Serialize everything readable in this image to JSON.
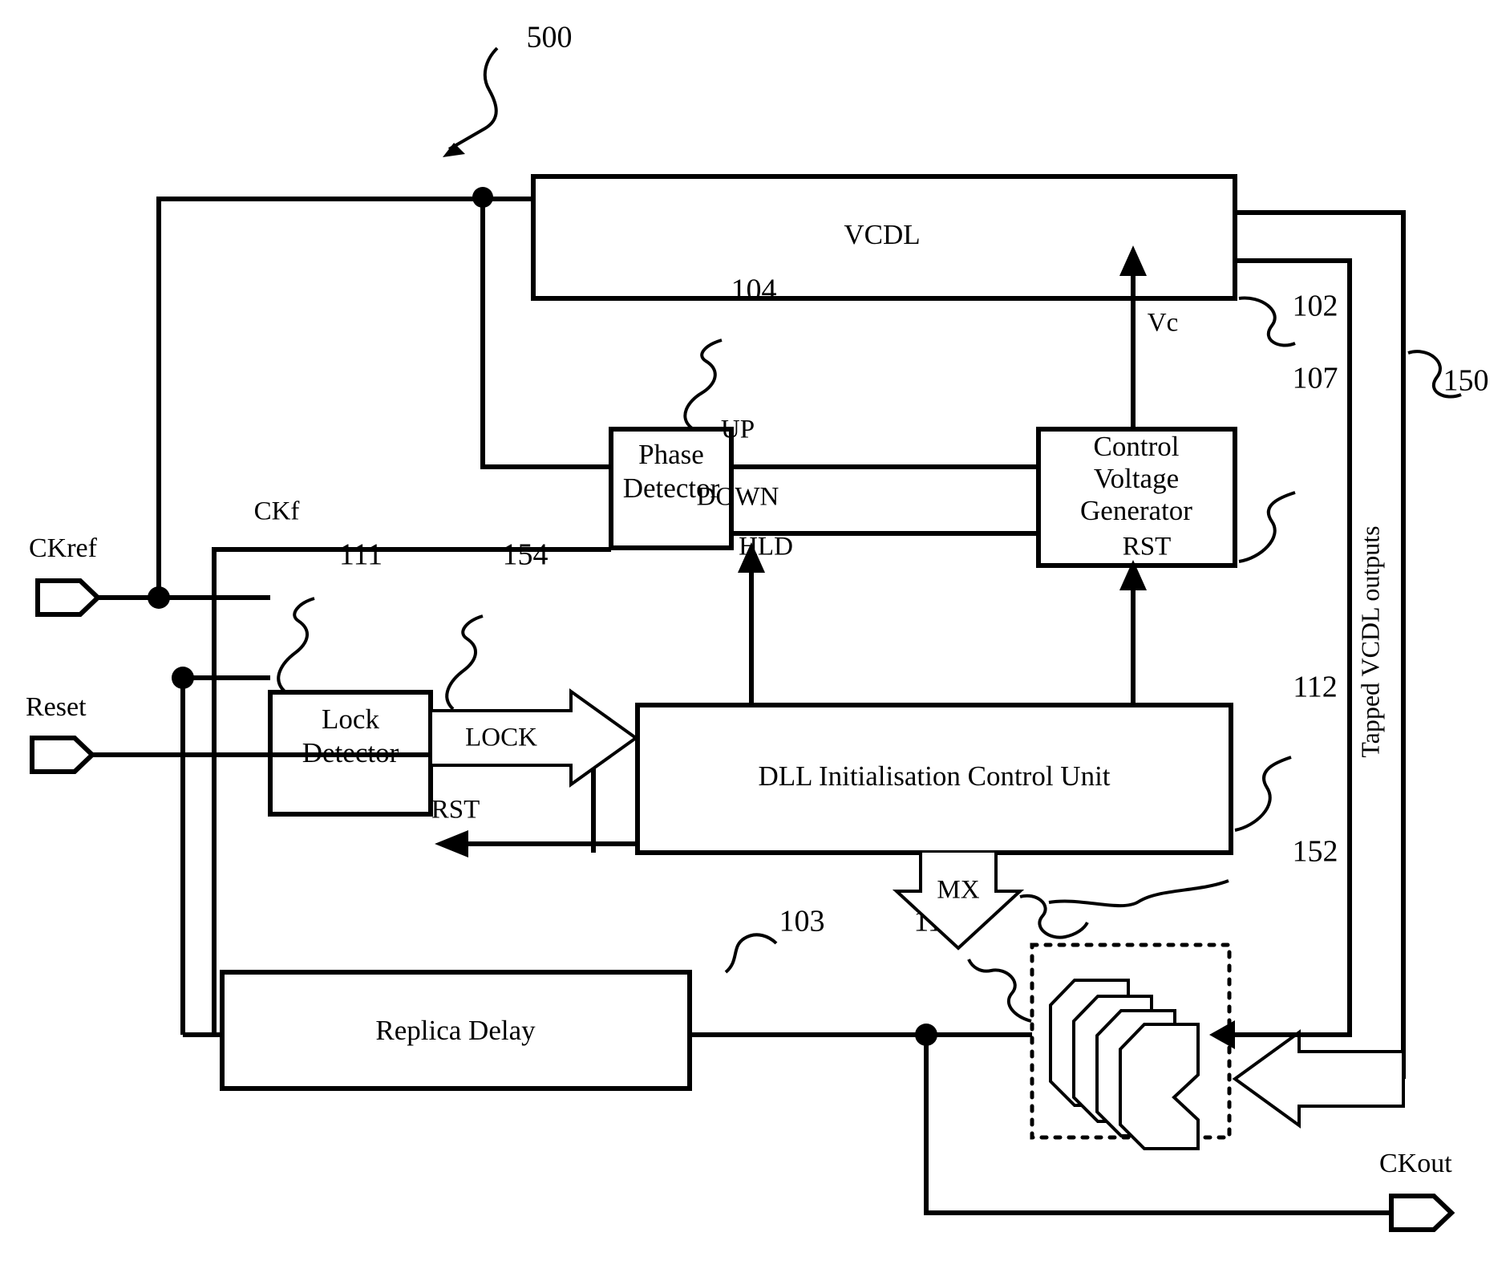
{
  "figure": {
    "number": "500",
    "blocks": [
      {
        "id": "vcdl",
        "label": "VCDL",
        "ref": "102"
      },
      {
        "id": "pd",
        "label": "Phase\nDetector",
        "ref": "104"
      },
      {
        "id": "cvg",
        "label": "Control\nVoltage\nGenerator",
        "ref": "107"
      },
      {
        "id": "lock",
        "label": "Lock\nDetector",
        "ref": "111"
      },
      {
        "id": "dllicu",
        "label": "DLL Initialisation Control Unit",
        "ref": "112"
      },
      {
        "id": "replica",
        "label": "Replica Delay",
        "ref": "103"
      },
      {
        "id": "mux",
        "label": "",
        "ref": "113"
      }
    ],
    "block_labels": {
      "vcdl": "VCDL",
      "phase": "Phase",
      "detector": "Detector",
      "control": "Control",
      "voltage": "Voltage",
      "generator": "Generator",
      "lock": "Lock",
      "lock_detector": "Detector",
      "dll_unit": "DLL Initialisation Control Unit",
      "replica_delay": "Replica Delay"
    },
    "refs": {
      "fig": "500",
      "vcdl": "102",
      "pd": "104",
      "cvg": "107",
      "lock": "111",
      "lock_bus": "154",
      "dll": "112",
      "mux_bus": "152",
      "mux": "113",
      "replica": "103",
      "tapped": "150"
    },
    "signals": {
      "up": "UP",
      "down": "DOWN",
      "vc": "Vc",
      "hld": "HLD",
      "rst_right": "RST",
      "rst_left": "RST",
      "lock": "LOCK",
      "mx": "MX",
      "ckf": "CKf",
      "tapped": "Tapped  VCDL outputs"
    },
    "ports": {
      "ckref": "CKref",
      "reset": "Reset",
      "ckout": "CKout"
    }
  }
}
